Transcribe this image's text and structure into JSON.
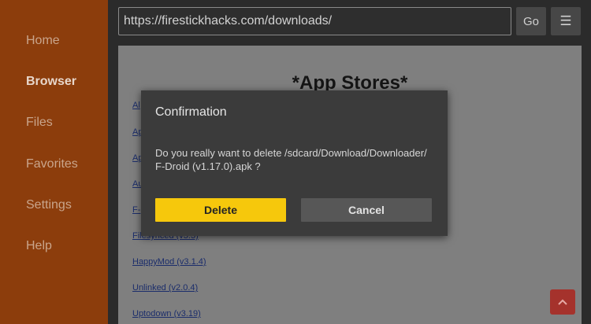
{
  "sidebar": {
    "items": [
      {
        "label": "Home"
      },
      {
        "label": "Browser"
      },
      {
        "label": "Files"
      },
      {
        "label": "Favorites"
      },
      {
        "label": "Settings"
      },
      {
        "label": "Help"
      }
    ]
  },
  "toolbar": {
    "url": "https://firestickhacks.com/downloads/",
    "go_label": "Go",
    "menu_icon": "☰"
  },
  "webpage": {
    "heading": "*App Stores*",
    "links": [
      {
        "text": "Al"
      },
      {
        "text": "Ap"
      },
      {
        "text": "Ap"
      },
      {
        "text": "Au"
      },
      {
        "text": "F-"
      },
      {
        "text": "Filesynced (v3.3)"
      },
      {
        "text": "HappyMod (v3.1.4)"
      },
      {
        "text": "Unlinked (v2.0.4)"
      },
      {
        "text": "Uptodown (v3.19)"
      }
    ]
  },
  "dialog": {
    "title": "Confirmation",
    "message_line1": "Do you really want to delete /sdcard/Download/Downloader/",
    "message_line2": "F-Droid (v1.17.0).apk ?",
    "delete_label": "Delete",
    "cancel_label": "Cancel"
  },
  "colors": {
    "sidebar_bg": "#8c3d0c",
    "delete_button": "#f6c80c",
    "scroll_top_button": "#a5322c"
  }
}
